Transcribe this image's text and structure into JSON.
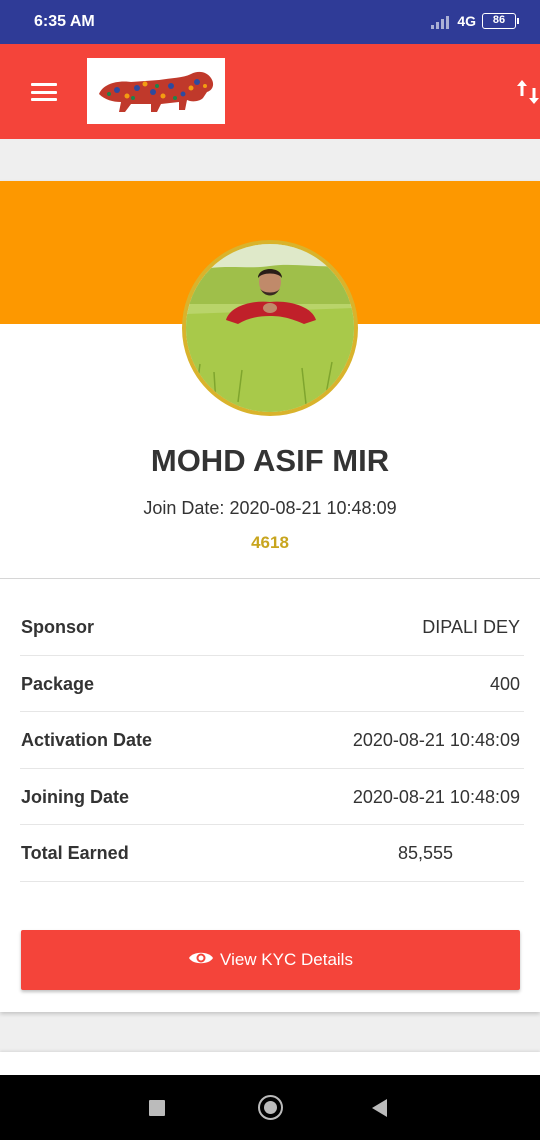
{
  "status_bar": {
    "time": "6:35 AM",
    "network": "4G",
    "battery": "86",
    "icons": [
      "signal-icon",
      "battery-icon"
    ]
  },
  "app_bar": {
    "menu_icon": "hamburger-menu-icon",
    "logo": "lion-logo",
    "sort_icon": "up-down-arrows-icon"
  },
  "profile": {
    "name": "MOHD ASIF MIR",
    "join_label": "Join Date:",
    "join_date": "2020-08-21 10:48:09",
    "member_id": "4618"
  },
  "details": [
    {
      "label": "Sponsor",
      "value": "DIPALI DEY"
    },
    {
      "label": "Package",
      "value": "400"
    },
    {
      "label": "Activation Date",
      "value": "2020-08-21 10:48:09"
    },
    {
      "label": "Joining Date",
      "value": "2020-08-21 10:48:09"
    },
    {
      "label": "Total Earned",
      "value": "85,555"
    }
  ],
  "kyc_button": {
    "label": "View KYC Details",
    "icon": "eye-icon"
  },
  "nav_bar": {
    "icons": [
      "recents-icon",
      "home-icon",
      "back-icon"
    ]
  },
  "colors": {
    "status_bar": "#2f3b97",
    "primary": "#f4443a",
    "banner": "#fd9800",
    "accent_gold": "#c8a51e"
  }
}
